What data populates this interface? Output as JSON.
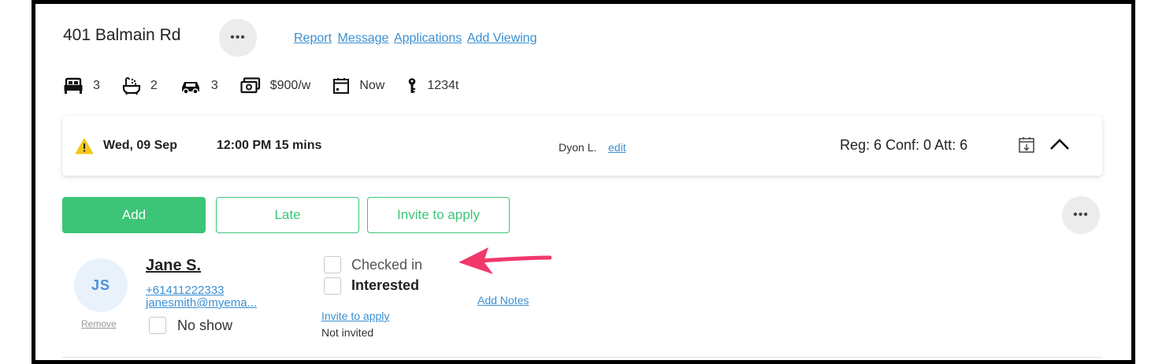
{
  "header": {
    "address": "401 Balmain Rd",
    "more_label": "•••",
    "links": [
      "Report",
      "Message",
      "Applications",
      "Add Viewing"
    ]
  },
  "features": {
    "bedrooms": "3",
    "bathrooms": "2",
    "parking": "3",
    "rent": "$900/w",
    "available": "Now",
    "key_code": "1234t"
  },
  "viewing": {
    "date": "Wed, 09 Sep",
    "time": "12:00 PM 15 mins",
    "host": "Dyon L.",
    "edit_label": "edit",
    "stats": "Reg: 6 Conf: 0  Att: 6"
  },
  "actions": {
    "add": "Add",
    "late": "Late",
    "invite": "Invite to apply",
    "more": "•••"
  },
  "attendee": {
    "initials": "JS",
    "remove_label": "Remove",
    "name": "Jane S.",
    "phone": "+61411222333",
    "email": "janesmith@myema...",
    "no_show": "No show",
    "checked_in": "Checked in",
    "interested": "Interested",
    "invite_link": "Invite to apply",
    "invite_status": "Not invited",
    "notes_link": "Add Notes"
  },
  "colors": {
    "accent_green": "#3cc477",
    "link_blue": "#3b8fd1",
    "warning_yellow": "#f5c518",
    "annotation_arrow": "#f0386b"
  }
}
